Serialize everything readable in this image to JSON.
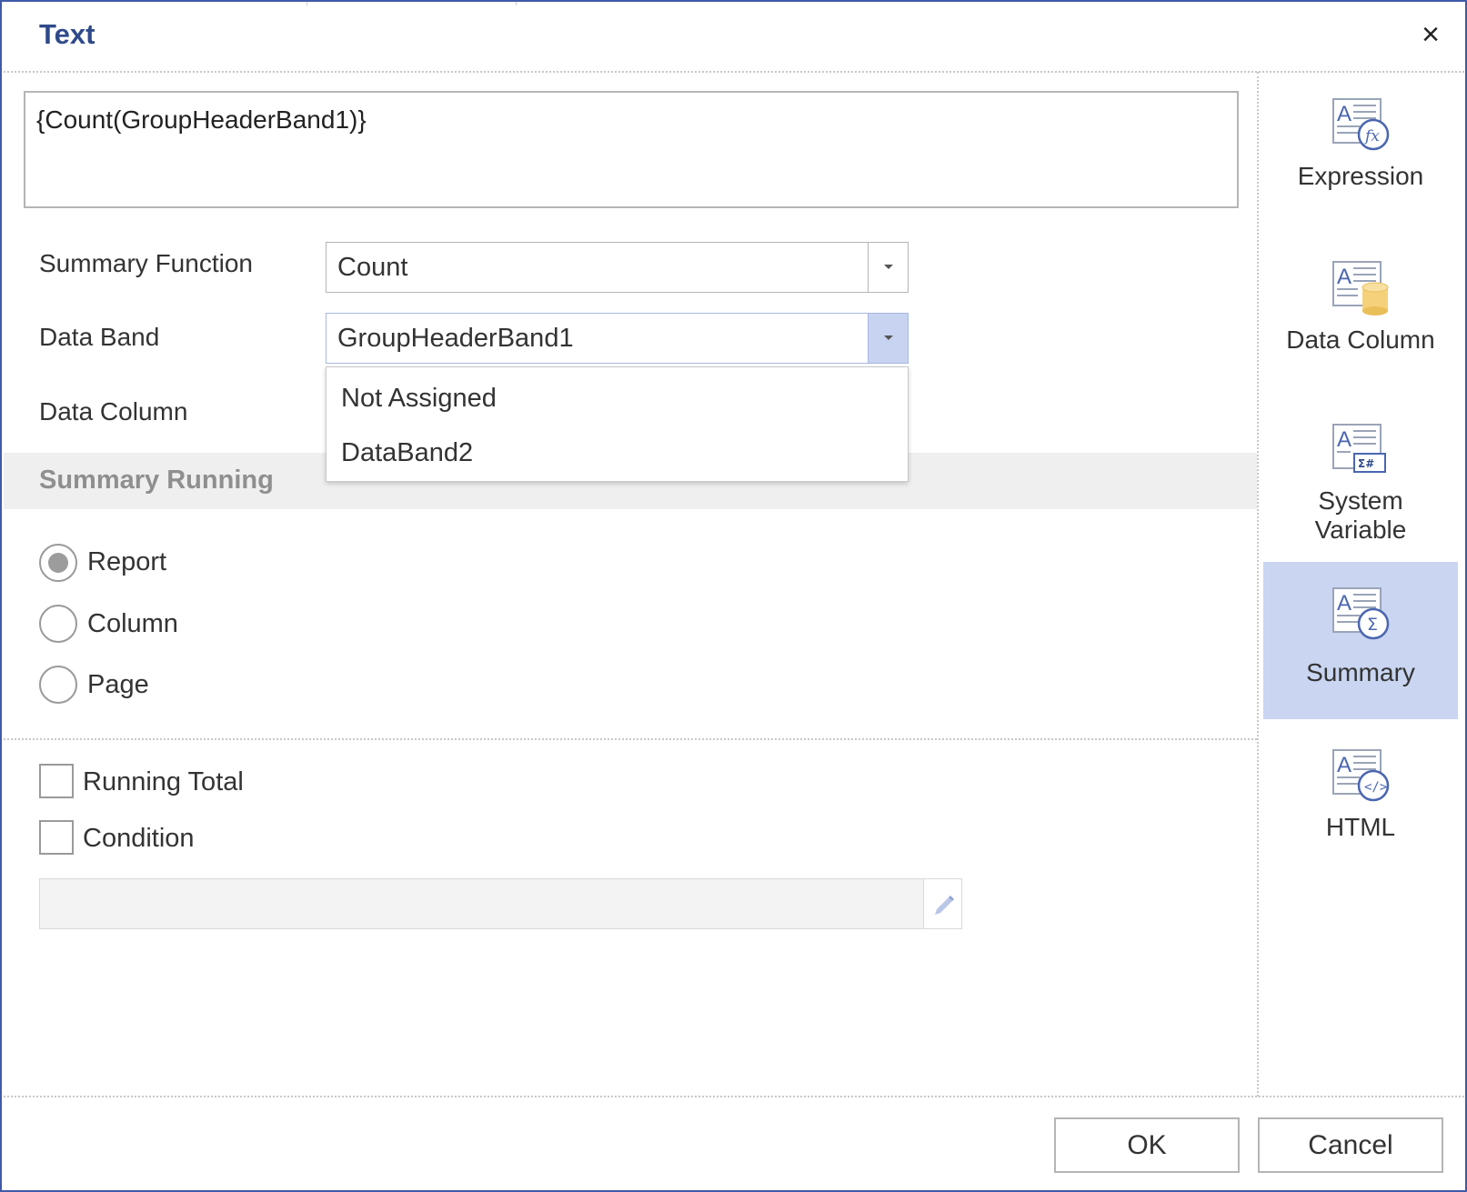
{
  "dialog": {
    "title": "Text",
    "close_glyph": "×"
  },
  "expression": {
    "value": "{Count(GroupHeaderBand1)}"
  },
  "form": {
    "summary_function": {
      "label": "Summary Function",
      "value": "Count"
    },
    "data_band": {
      "label": "Data Band",
      "value": "GroupHeaderBand1"
    },
    "data_column": {
      "label": "Data Column"
    }
  },
  "dropdown": {
    "options": [
      "Not Assigned",
      "DataBand2"
    ]
  },
  "summary_running": {
    "title": "Summary Running",
    "options": [
      {
        "label": "Report",
        "selected": true
      },
      {
        "label": "Column",
        "selected": false
      },
      {
        "label": "Page",
        "selected": false
      }
    ]
  },
  "checkboxes": {
    "running_total": "Running Total",
    "condition": "Condition"
  },
  "condition_input": {
    "value": ""
  },
  "sidebar": {
    "items": [
      {
        "label": "Expression",
        "icon": "expression-icon",
        "selected": false
      },
      {
        "label": "Data Column",
        "icon": "data-column-icon",
        "selected": false
      },
      {
        "label": "System",
        "label2": "Variable",
        "icon": "system-variable-icon",
        "selected": false
      },
      {
        "label": "Summary",
        "icon": "summary-icon",
        "selected": true
      },
      {
        "label": "HTML",
        "icon": "html-icon",
        "selected": false
      }
    ]
  },
  "footer": {
    "ok_label": "OK",
    "cancel_label": "Cancel"
  },
  "colors": {
    "accent": "#3f5aa8",
    "title": "#2f4a8a",
    "selected_bg": "#c9d5f1",
    "icon_blue": "#4a66b0",
    "icon_gold": "#f5d27a"
  }
}
